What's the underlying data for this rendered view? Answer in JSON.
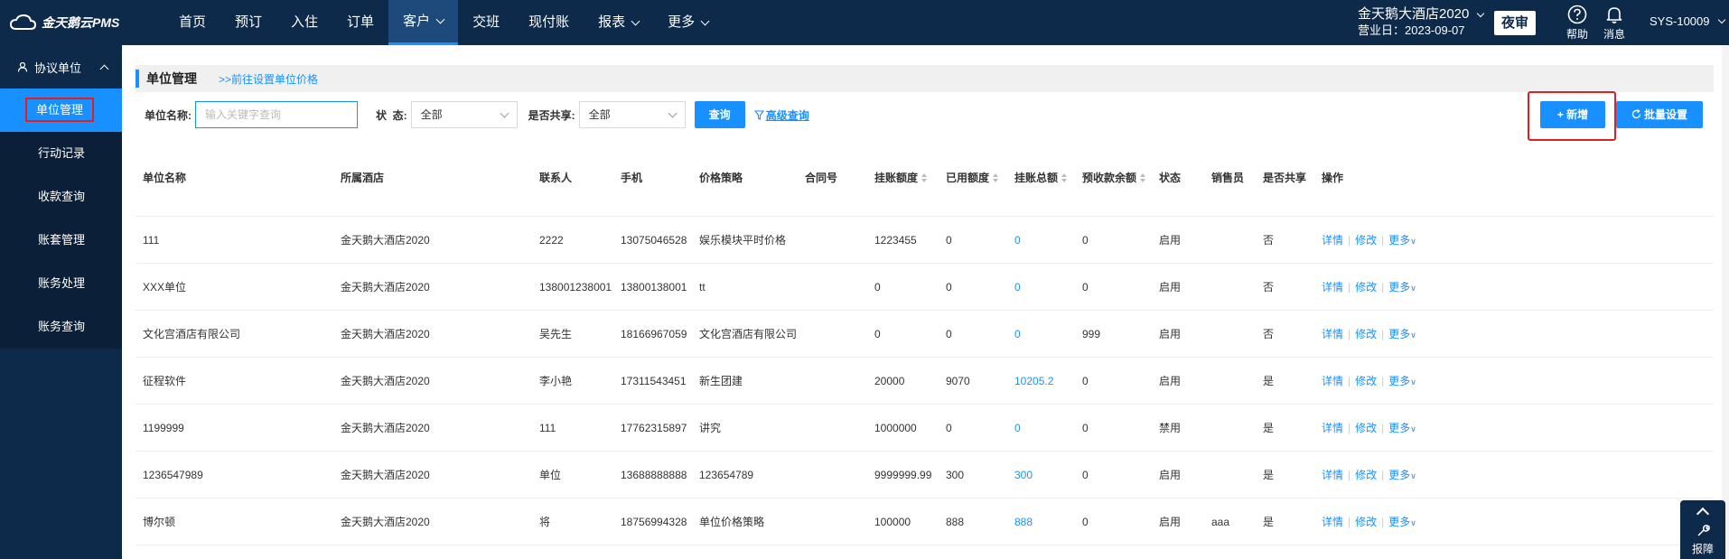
{
  "app": {
    "logo_text": "金天鹅云PMS"
  },
  "nav": [
    {
      "label": "首页",
      "dropdown": false,
      "active": false
    },
    {
      "label": "预订",
      "dropdown": false,
      "active": false
    },
    {
      "label": "入住",
      "dropdown": false,
      "active": false
    },
    {
      "label": "订单",
      "dropdown": false,
      "active": false
    },
    {
      "label": "客户",
      "dropdown": true,
      "active": true
    },
    {
      "label": "交班",
      "dropdown": false,
      "active": false
    },
    {
      "label": "现付账",
      "dropdown": false,
      "active": false
    },
    {
      "label": "报表",
      "dropdown": true,
      "active": false
    },
    {
      "label": "更多",
      "dropdown": true,
      "active": false
    }
  ],
  "header": {
    "hotel_name": "金天鹅大酒店2020",
    "business_date": "营业日：2023-09-07",
    "night_audit": "夜审",
    "help": "帮助",
    "messages": "消息",
    "user": "SYS-10009"
  },
  "sidebar": {
    "group": "协议单位",
    "items": [
      "单位管理",
      "行动记录",
      "收款查询",
      "账套管理",
      "账务处理",
      "账务查询"
    ],
    "active_index": 0
  },
  "main": {
    "title": "单位管理",
    "price_link": ">>前往设置单位价格",
    "filters": {
      "name_label": "单位名称:",
      "name_placeholder": "输入关键字查询",
      "status_label": "状  态:",
      "status_value": "全部",
      "shared_label": "是否共享:",
      "shared_value": "全部",
      "query": "查询",
      "advanced": "高级查询"
    },
    "add_button": "+ 新增",
    "batch_button": "批量设置"
  },
  "table": {
    "columns": [
      "单位名称",
      "所属酒店",
      "联系人",
      "手机",
      "价格策略",
      "合同号",
      "挂账额度",
      "已用额度",
      "挂账总额",
      "预收款余额",
      "状态",
      "销售员",
      "是否共享",
      "操作"
    ],
    "rows": [
      [
        "111",
        "金天鹅大酒店2020",
        "2222",
        "13075046528",
        "娱乐模块平时价格",
        "",
        "1223455",
        "0",
        "0",
        "0",
        "启用",
        "",
        "否"
      ],
      [
        "XXX单位",
        "金天鹅大酒店2020",
        "138001238001",
        "13800138001",
        "tt",
        "",
        "0",
        "0",
        "0",
        "0",
        "启用",
        "",
        "否"
      ],
      [
        "文化宫酒店有限公司",
        "金天鹅大酒店2020",
        "吴先生",
        "18166967059",
        "文化宫酒店有限公司",
        "",
        "0",
        "0",
        "0",
        "999",
        "启用",
        "",
        "否"
      ],
      [
        "征程软件",
        "金天鹅大酒店2020",
        "李小艳",
        "17311543451",
        "新生团建",
        "",
        "20000",
        "9070",
        "10205.2",
        "0",
        "启用",
        "",
        "是"
      ],
      [
        "1199999",
        "金天鹅大酒店2020",
        "111",
        "17762315897",
        "讲究",
        "",
        "1000000",
        "0",
        "0",
        "0",
        "禁用",
        "",
        "是"
      ],
      [
        "1236547989",
        "金天鹅大酒店2020",
        "单位",
        "13688888888",
        "123654789",
        "",
        "9999999.99",
        "300",
        "300",
        "0",
        "启用",
        "",
        "是"
      ],
      [
        "博尔顿",
        "金天鹅大酒店2020",
        "将",
        "18756994328",
        "单位价格策略",
        "",
        "100000",
        "888",
        "888",
        "0",
        "启用",
        "aaa",
        "是"
      ]
    ],
    "ops": [
      "详情",
      "修改",
      "更多"
    ]
  },
  "float_tool": {
    "label": "报障"
  }
}
